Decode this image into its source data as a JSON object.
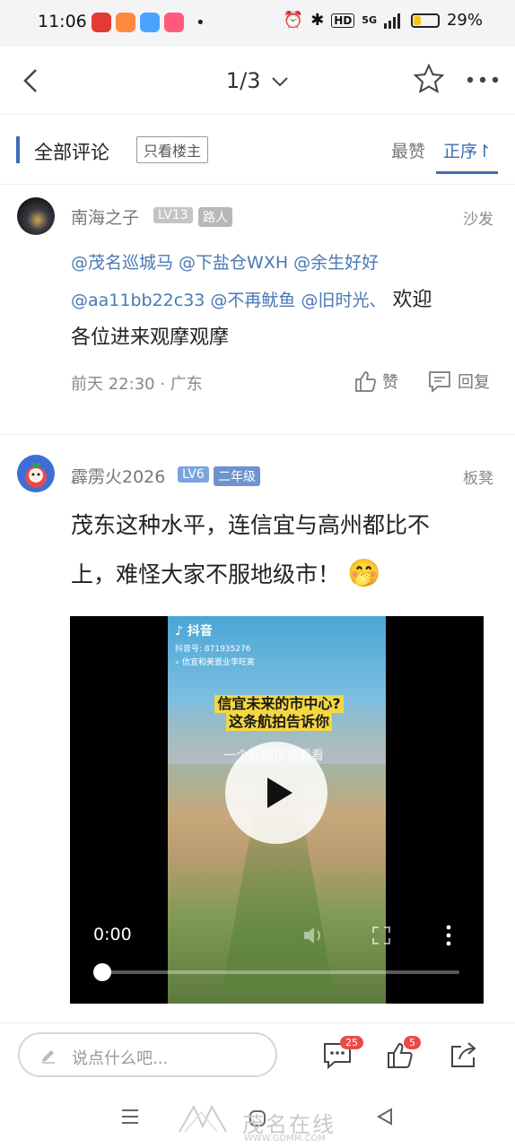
{
  "status_bar": {
    "time": "11:06",
    "hd": "HD",
    "network": "5G",
    "battery": "29%",
    "battery_level": 0.29
  },
  "nav": {
    "page_indicator": "1/3"
  },
  "tabs": {
    "title": "全部评论",
    "only_op": "只看楼主",
    "sort_hot": "最赞",
    "sort_order": "正序↾"
  },
  "comments": [
    {
      "username": "南海之子",
      "level": "LV13",
      "rank": "路人",
      "floor": "沙发",
      "mentions_line1": "@茂名巡城马 @下盐仓WXH @余生好好",
      "mentions_line2": "@aa11bb22c33 @不再鱿鱼 @旧时光、",
      "text_inline": "欢迎",
      "text_line3": "各位进来观摩观摩",
      "time": "前天 22:30 · 广东",
      "like_label": "赞",
      "reply_label": "回复"
    },
    {
      "username": "霹雳火2026",
      "level": "LV6",
      "rank": "二年级",
      "floor": "板凳",
      "text_line1": "茂东这种水平，连信宜与高州都比不",
      "text_line2": "上，难怪大家不服地级市！",
      "emoji": "🤭",
      "video": {
        "app_name": "抖音",
        "account": "抖音号: 871935276",
        "search_hint": "信宜和美置业李旺离",
        "caption_line1": "信宜未来的市中心?",
        "caption_line2": "这条航拍告诉你",
        "subtitle": "一个视频带你看看",
        "current_time": "0:00",
        "progress": 0
      }
    }
  ],
  "bottom_bar": {
    "input_placeholder": "说点什么吧...",
    "comment_count": "25",
    "like_count": "5"
  },
  "watermark": {
    "brand": "茂名在线",
    "url": "WWW.GDMM.COM"
  },
  "colors": {
    "accent": "#3d6cb3",
    "mention": "#4a78b5",
    "badge_gray": "#c4c4c4",
    "badge_blue": "#7aa4de",
    "badge_blue_dark": "#6c93cf",
    "count_red": "#e94b4b"
  }
}
